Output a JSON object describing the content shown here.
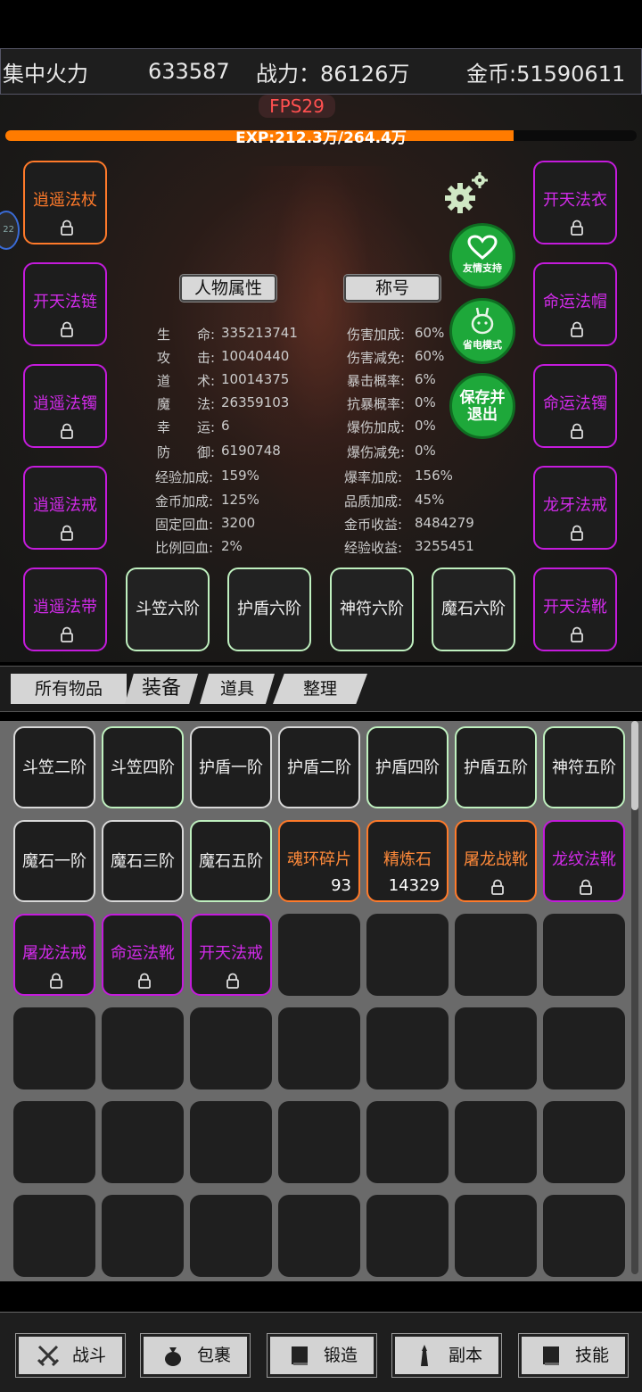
{
  "topbar": {
    "mode": "集中火力",
    "value": "633587",
    "power": "战力：86126万",
    "gold": "金币:51590611"
  },
  "hud": {
    "fps": "FPS29",
    "exp_text": "EXP:212.3万/264.4万",
    "exp_progress": 0.805,
    "side_badge": "22"
  },
  "left_slots": [
    {
      "label": "逍遥法杖",
      "color": "orange"
    },
    {
      "label": "开天法链",
      "color": "purple"
    },
    {
      "label": "逍遥法镯",
      "color": "purple"
    },
    {
      "label": "逍遥法戒",
      "color": "purple"
    },
    {
      "label": "逍遥法带",
      "color": "purple"
    }
  ],
  "right_slots": [
    {
      "label": "开天法衣",
      "color": "purple"
    },
    {
      "label": "命运法帽",
      "color": "purple"
    },
    {
      "label": "命运法镯",
      "color": "purple"
    },
    {
      "label": "龙牙法戒",
      "color": "purple"
    },
    {
      "label": "开天法靴",
      "color": "purple"
    }
  ],
  "bottom_slots": [
    "斗笠六阶",
    "护盾六阶",
    "神符六阶",
    "魔石六阶"
  ],
  "panel_tabs": {
    "attributes": "人物属性",
    "title": "称号"
  },
  "stats_left": [
    {
      "k": "生　　命:",
      "v": "335213741"
    },
    {
      "k": "攻　　击:",
      "v": "10040440"
    },
    {
      "k": "道　　术:",
      "v": "10014375"
    },
    {
      "k": "魔　　法:",
      "v": "26359103"
    },
    {
      "k": "幸　　运:",
      "v": "6"
    },
    {
      "k": "防　　御:",
      "v": "6190748"
    }
  ],
  "stats_right": [
    {
      "k": "伤害加成:",
      "v": "60%"
    },
    {
      "k": "伤害减免:",
      "v": "60%"
    },
    {
      "k": "暴击概率:",
      "v": "6%"
    },
    {
      "k": "抗暴概率:",
      "v": "0%"
    },
    {
      "k": "爆伤加成:",
      "v": "0%"
    },
    {
      "k": "爆伤减免:",
      "v": "0%"
    }
  ],
  "stats_left2": [
    {
      "k": "经验加成:",
      "v": "159%"
    },
    {
      "k": "金币加成:",
      "v": "125%"
    },
    {
      "k": "固定回血:",
      "v": "3200"
    },
    {
      "k": "比例回血:",
      "v": "2%"
    }
  ],
  "stats_right2": [
    {
      "k": "爆率加成:",
      "v": "156%"
    },
    {
      "k": "品质加成:",
      "v": "45%"
    },
    {
      "k": "金币收益:",
      "v": "8484279"
    },
    {
      "k": "经验收益:",
      "v": "3255451"
    }
  ],
  "side_buttons": {
    "support": "友情支持",
    "power_save": "省电模式",
    "save_exit_1": "保存并",
    "save_exit_2": "退出"
  },
  "inventory_tabs": [
    "所有物品",
    "装备",
    "道具",
    "整理"
  ],
  "inventory": [
    {
      "label": "斗笠二阶",
      "style": "white"
    },
    {
      "label": "斗笠四阶",
      "style": "green"
    },
    {
      "label": "护盾一阶",
      "style": "white"
    },
    {
      "label": "护盾二阶",
      "style": "white"
    },
    {
      "label": "护盾四阶",
      "style": "green"
    },
    {
      "label": "护盾五阶",
      "style": "green"
    },
    {
      "label": "神符五阶",
      "style": "green"
    },
    {
      "label": "魔石一阶",
      "style": "white"
    },
    {
      "label": "魔石三阶",
      "style": "white"
    },
    {
      "label": "魔石五阶",
      "style": "green"
    },
    {
      "label": "魂环碎片",
      "style": "orange",
      "count": "93"
    },
    {
      "label": "精炼石",
      "style": "orange",
      "count": "14329"
    },
    {
      "label": "屠龙战靴",
      "style": "orange",
      "locked": true
    },
    {
      "label": "龙纹法靴",
      "style": "purple",
      "locked": true
    },
    {
      "label": "屠龙法戒",
      "style": "purple",
      "locked": true
    },
    {
      "label": "命运法靴",
      "style": "purple",
      "locked": true
    },
    {
      "label": "开天法戒",
      "style": "purple",
      "locked": true
    }
  ],
  "nav": [
    "战斗",
    "包裹",
    "锻造",
    "副本",
    "技能"
  ]
}
